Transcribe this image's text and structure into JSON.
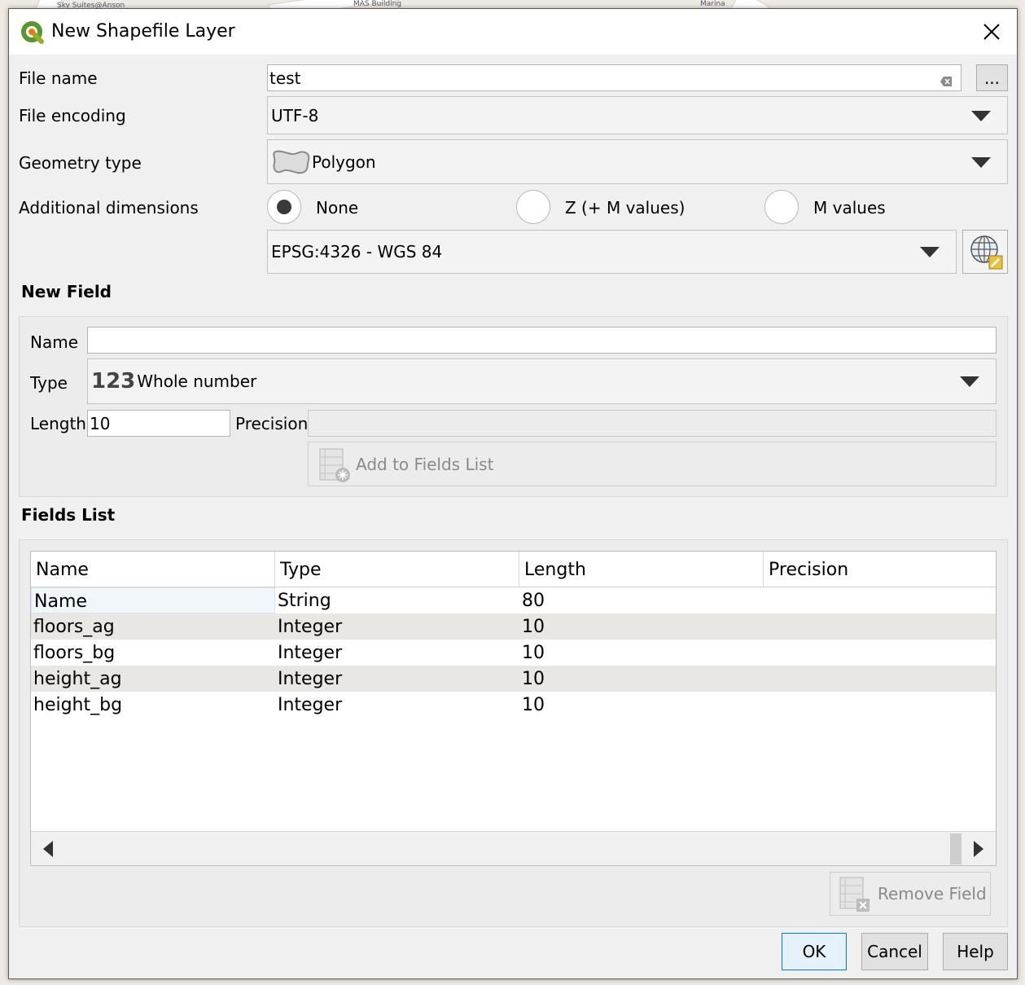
{
  "background": {
    "map_labels": [
      "Sky Suites@Anson",
      "MAS Building",
      "Marina"
    ]
  },
  "window": {
    "title": "New Shapefile Layer",
    "icon": "qgis-logo-icon"
  },
  "form": {
    "file_name_label": "File name",
    "file_name_value": "test",
    "browse_label": "...",
    "encoding_label": "File encoding",
    "encoding_value": "UTF-8",
    "geometry_label": "Geometry type",
    "geometry_value": "Polygon",
    "dimensions_label": "Additional dimensions",
    "dimensions_options": [
      {
        "label": "None",
        "checked": true
      },
      {
        "label": "Z (+ M values)",
        "checked": false
      },
      {
        "label": "M values",
        "checked": false
      }
    ],
    "crs_value": "EPSG:4326 - WGS 84"
  },
  "new_field": {
    "heading": "New Field",
    "name_label": "Name",
    "name_value": "",
    "type_label": "Type",
    "type_icon_text": "123",
    "type_value": "Whole number",
    "length_label": "Length",
    "length_value": "10",
    "precision_label": "Precision",
    "precision_value": "",
    "add_button": "Add to Fields List"
  },
  "fields_list": {
    "heading": "Fields List",
    "columns": [
      "Name",
      "Type",
      "Length",
      "Precision"
    ],
    "rows": [
      {
        "name": "Name",
        "type": "String",
        "length": "80",
        "precision": ""
      },
      {
        "name": "floors_ag",
        "type": "Integer",
        "length": "10",
        "precision": ""
      },
      {
        "name": "floors_bg",
        "type": "Integer",
        "length": "10",
        "precision": ""
      },
      {
        "name": "height_ag",
        "type": "Integer",
        "length": "10",
        "precision": ""
      },
      {
        "name": "height_bg",
        "type": "Integer",
        "length": "10",
        "precision": ""
      }
    ],
    "remove_button": "Remove Field"
  },
  "buttons": {
    "ok": "OK",
    "cancel": "Cancel",
    "help": "Help"
  }
}
